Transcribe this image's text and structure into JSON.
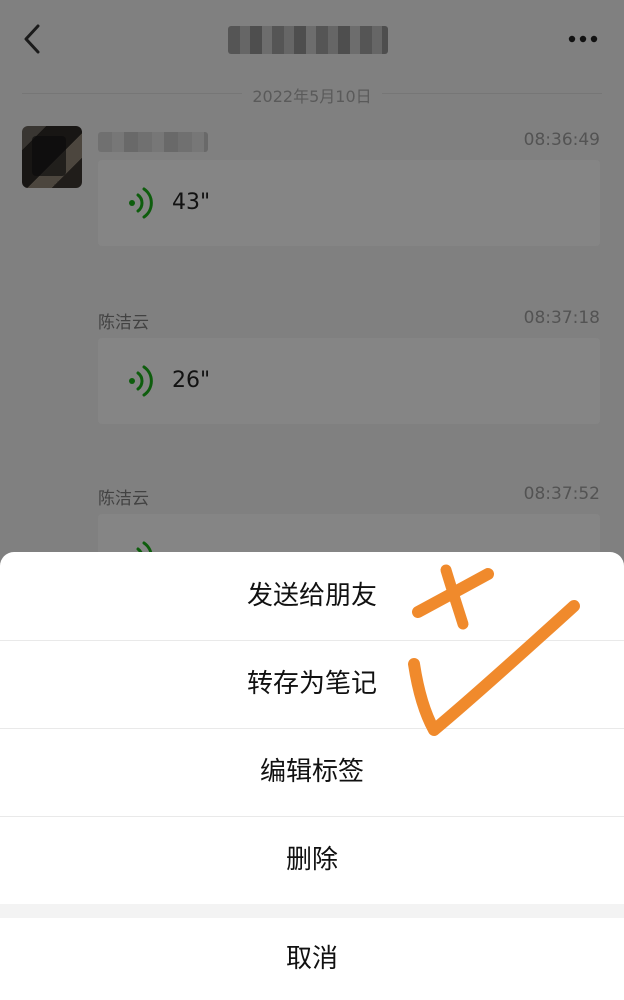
{
  "header": {
    "back_icon": "chevron-left-icon",
    "more_icon": "ellipsis-icon"
  },
  "chat": {
    "date": "2022年5月10日",
    "messages": [
      {
        "sender": "",
        "time": "08:36:49",
        "duration": "43\""
      },
      {
        "sender": "陈洁云",
        "time": "08:37:18",
        "duration": "26\""
      },
      {
        "sender": "陈洁云",
        "time": "08:37:52",
        "duration": ""
      }
    ],
    "voice_icon": "voice-wave-icon",
    "voice_color": "#1aad19"
  },
  "action_sheet": {
    "items": [
      "发送给朋友",
      "转存为笔记",
      "编辑标签",
      "删除"
    ],
    "cancel_label": "取消"
  },
  "annotation": {
    "color": "#f08a2c",
    "marks": [
      "cross-mark",
      "check-mark"
    ]
  }
}
